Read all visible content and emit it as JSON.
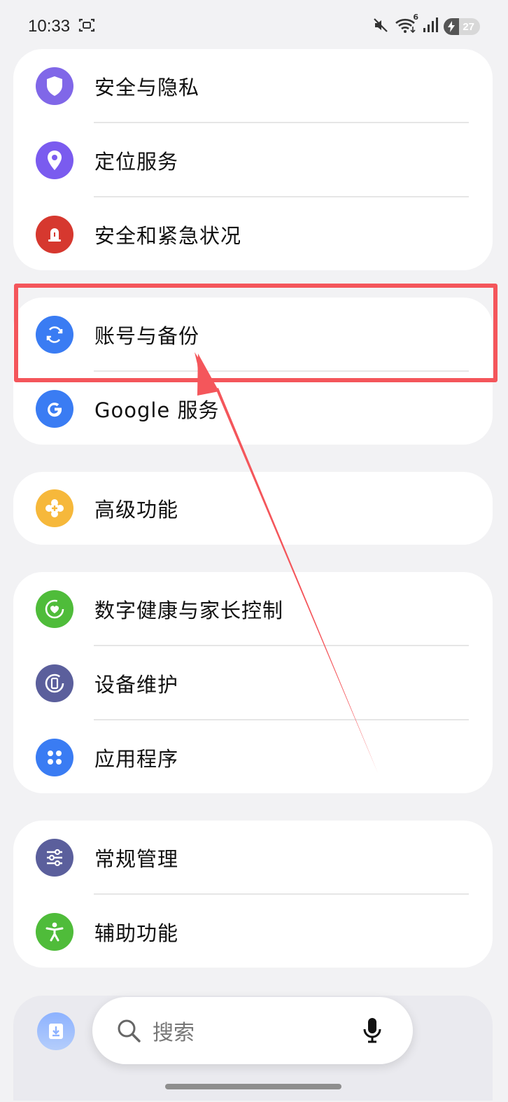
{
  "status_bar": {
    "time": "10:33",
    "network_label": "6",
    "battery": "27"
  },
  "groups": [
    {
      "items": [
        {
          "label": "安全与隐私",
          "icon": "shield-icon",
          "color": "#8067e8"
        },
        {
          "label": "定位服务",
          "icon": "location-pin-icon",
          "color": "#7a5bef"
        },
        {
          "label": "安全和紧急状况",
          "icon": "emergency-light-icon",
          "color": "#d6382f"
        }
      ]
    },
    {
      "items": [
        {
          "label": "账号与备份",
          "icon": "sync-icon",
          "color": "#3a7cf3"
        },
        {
          "label": "Google 服务",
          "icon": "google-g-icon",
          "color": "#3a7cf3"
        }
      ]
    },
    {
      "items": [
        {
          "label": "高级功能",
          "icon": "puzzle-plus-icon",
          "color": "#f6b83b"
        }
      ]
    },
    {
      "items": [
        {
          "label": "数字健康与家长控制",
          "icon": "heart-ring-icon",
          "color": "#4fbc3a"
        },
        {
          "label": "设备维护",
          "icon": "device-care-icon",
          "color": "#5b5f9c"
        },
        {
          "label": "应用程序",
          "icon": "apps-grid-icon",
          "color": "#3a7cf3"
        }
      ]
    },
    {
      "items": [
        {
          "label": "常规管理",
          "icon": "sliders-icon",
          "color": "#5b5f9c"
        },
        {
          "label": "辅助功能",
          "icon": "accessibility-icon",
          "color": "#4fbc3a"
        }
      ]
    }
  ],
  "search": {
    "placeholder": "搜索"
  },
  "colors": {
    "highlight": "#f4565b",
    "background": "#f2f2f4"
  }
}
